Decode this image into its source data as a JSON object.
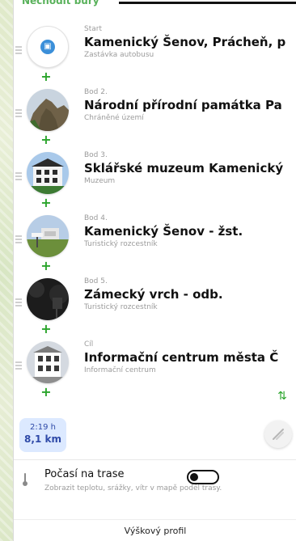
{
  "header": {
    "partial_label": "Nechodit bury"
  },
  "points": [
    {
      "role": "Start",
      "title": "Kamenický Šenov, Prácheň, p",
      "type": "Zastávka autobusu",
      "avatar": "bus-stop"
    },
    {
      "role": "Bod 2.",
      "title": "Národní přírodní památka Pa",
      "type": "Chráněné území",
      "avatar": "rock-formation"
    },
    {
      "role": "Bod 3.",
      "title": "Sklářské muzeum Kamenický",
      "type": "Muzeum",
      "avatar": "museum-building"
    },
    {
      "role": "Bod 4.",
      "title": "Kamenický Šenov - žst.",
      "type": "Turistický rozcestník",
      "avatar": "train-station-sign"
    },
    {
      "role": "Bod 5.",
      "title": "Zámecký vrch - odb.",
      "type": "Turistický rozcestník",
      "avatar": "forest-sign"
    },
    {
      "role": "Cíl",
      "title": "Informační centrum města Č",
      "type": "Informační centrum",
      "avatar": "town-house"
    }
  ],
  "actions": {
    "add_symbol": "+",
    "swap_symbol": "⇅"
  },
  "metrics": {
    "time": "2:19 h",
    "distance": "8,1 km"
  },
  "weather": {
    "title": "Počasí na trase",
    "description": "Zobrazit teplotu, srážky, vítr v mapě podél trasy.",
    "toggle_on": false
  },
  "footer": {
    "elevation_label": "Výškový profil"
  },
  "colors": {
    "accent_green": "#2aa42b",
    "metrics_bg": "#dce9ff",
    "metrics_text": "#2f4aa8"
  }
}
